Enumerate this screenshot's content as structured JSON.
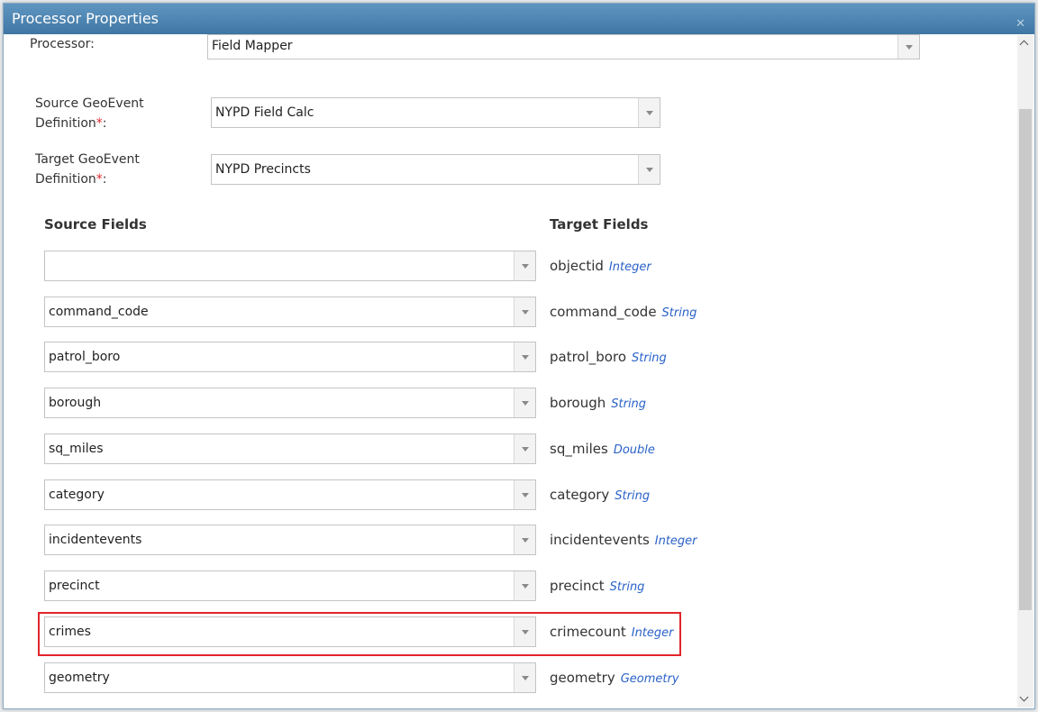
{
  "dialog": {
    "title": "Processor Properties",
    "close_icon": "close-icon"
  },
  "processor": {
    "label": "Processor:",
    "value": "Field Mapper"
  },
  "source_def": {
    "label_line1": "Source GeoEvent",
    "label_line2": "Definition",
    "required": "*",
    "colon": ":",
    "value": "NYPD Field Calc"
  },
  "target_def": {
    "label_line1": "Target GeoEvent",
    "label_line2": "Definition",
    "required": "*",
    "colon": ":",
    "value": "NYPD Precincts"
  },
  "columns": {
    "source": "Source Fields",
    "target": "Target Fields"
  },
  "mappings": [
    {
      "source": "",
      "target": "objectid",
      "type": "Integer"
    },
    {
      "source": "command_code",
      "target": "command_code",
      "type": "String"
    },
    {
      "source": "patrol_boro",
      "target": "patrol_boro",
      "type": "String"
    },
    {
      "source": "borough",
      "target": "borough",
      "type": "String"
    },
    {
      "source": "sq_miles",
      "target": "sq_miles",
      "type": "Double"
    },
    {
      "source": "category",
      "target": "category",
      "type": "String"
    },
    {
      "source": "incidentevents",
      "target": "incidentevents",
      "type": "Integer"
    },
    {
      "source": "precinct",
      "target": "precinct",
      "type": "String"
    },
    {
      "source": "crimes",
      "target": "crimecount",
      "type": "Integer"
    },
    {
      "source": "geometry",
      "target": "geometry",
      "type": "Geometry"
    }
  ],
  "colors": {
    "titlebar": "#4a83b1",
    "required": "#e0262b",
    "type_text": "#2a62c9",
    "highlight": "#e0262b"
  }
}
